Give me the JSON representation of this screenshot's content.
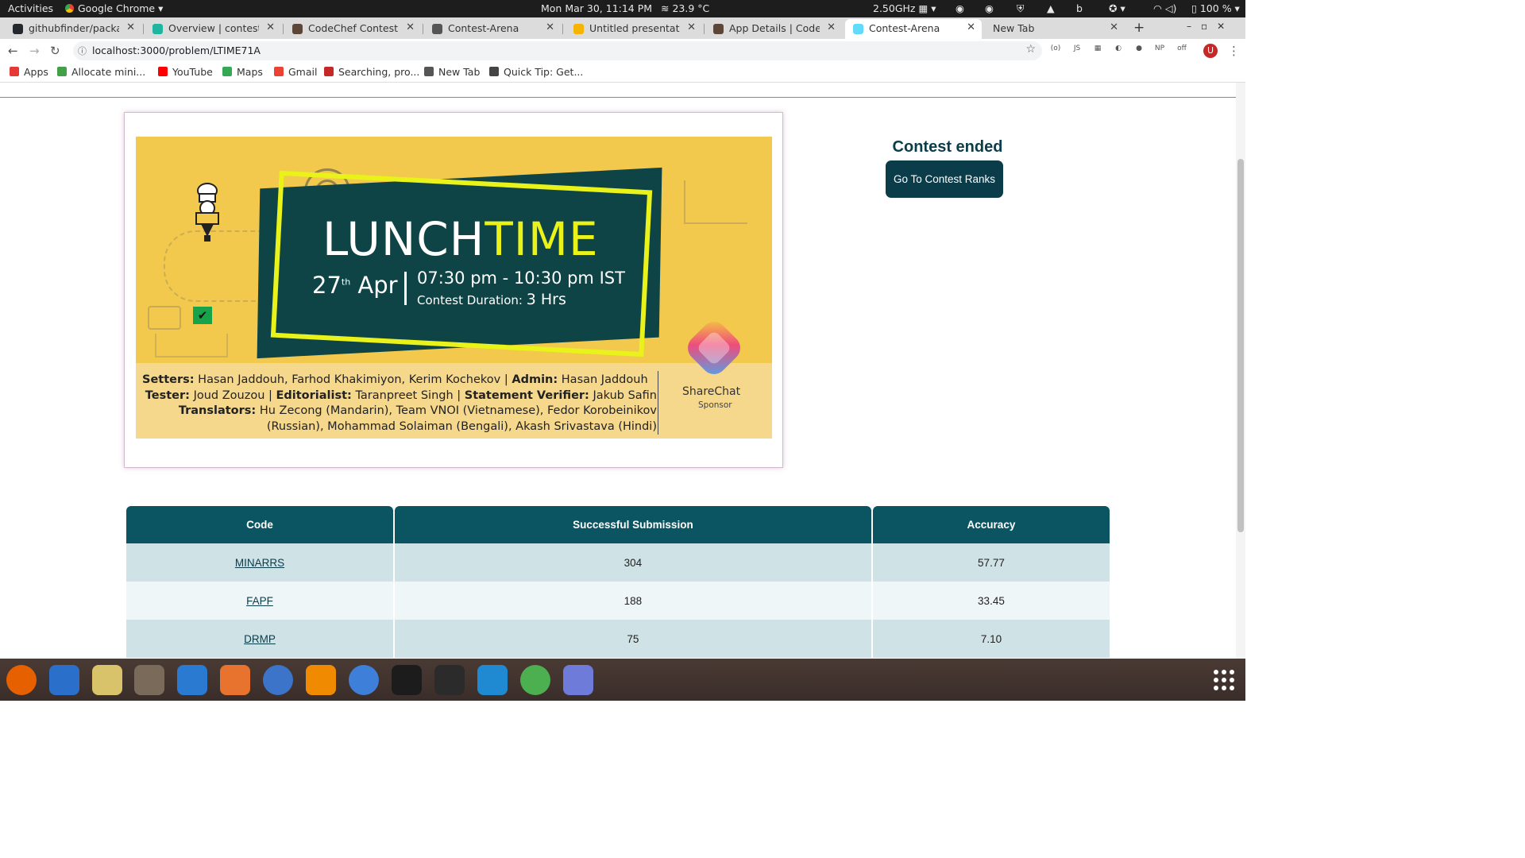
{
  "system": {
    "activities": "Activities",
    "app_name": "Google Chrome",
    "clock": "Mon Mar 30, 11:14 PM",
    "temperature": "23.9 °C",
    "cpu": "2.50GHz",
    "battery": "100 %"
  },
  "tabs": [
    {
      "label": "githubfinder/package",
      "icon_color": "#24292e"
    },
    {
      "label": "Overview | contestare",
      "icon_color": "#1fb5a0"
    },
    {
      "label": "CodeChef Contest Are",
      "icon_color": "#5b4638"
    },
    {
      "label": "Contest-Arena",
      "icon_color": "#555555"
    },
    {
      "label": "Untitled presentation",
      "icon_color": "#f4b400"
    },
    {
      "label": "App Details | CodeChe",
      "icon_color": "#5b4638"
    },
    {
      "label": "Contest-Arena",
      "icon_color": "#61dafb"
    },
    {
      "label": "New Tab",
      "icon_color": "#dcdcdc"
    }
  ],
  "new_tab_symbol": "+",
  "address_bar": {
    "url": "localhost:3000/problem/LTIME71A"
  },
  "bookmarks": [
    {
      "label": "Apps",
      "icon_color": "#e53935"
    },
    {
      "label": "Allocate mini...",
      "icon_color": "#43a047"
    },
    {
      "label": "YouTube",
      "icon_color": "#ff0000"
    },
    {
      "label": "Maps",
      "icon_color": "#34a853"
    },
    {
      "label": "Gmail",
      "icon_color": "#ea4335"
    },
    {
      "label": "Searching, pro...",
      "icon_color": "#c62828"
    },
    {
      "label": "New Tab",
      "icon_color": "#555555"
    },
    {
      "label": "Quick Tip: Get...",
      "icon_color": "#444444"
    }
  ],
  "extensions": [
    {
      "name": "reader-icon",
      "label": "(o)"
    },
    {
      "name": "node-icon",
      "label": "JS"
    },
    {
      "name": "grid-icon",
      "label": "▦"
    },
    {
      "name": "user-icon",
      "label": "◐"
    },
    {
      "name": "cookie-icon",
      "label": "●"
    },
    {
      "name": "np-icon",
      "label": "NP"
    },
    {
      "name": "toggle-off-icon",
      "label": "off"
    }
  ],
  "profile_initial": "U",
  "banner": {
    "title_part1": "LUNCH",
    "title_part2": "TIME",
    "date_day": "27",
    "date_suffix": "th",
    "date_month": "Apr",
    "time": "07:30 pm - 10:30 pm IST",
    "duration_label": "Contest Duration:",
    "duration_value": "3 Hrs",
    "credits_line1_label_a": "Setters:",
    "credits_line1_value_a": "Hasan Jaddouh, Farhod Khakimiyon, Kerim Kochekov",
    "credits_line1_label_b": "Admin:",
    "credits_line1_value_b": "Hasan Jaddouh",
    "credits_line2_label_a": "Tester:",
    "credits_line2_value_a": "Joud Zouzou",
    "credits_line2_label_b": "Editorialist:",
    "credits_line2_value_b": "Taranpreet Singh",
    "credits_line2_label_c": "Statement Verifier:",
    "credits_line2_value_c": "Jakub Safin",
    "credits_line3_label": "Translators:",
    "credits_line3_value": "Hu Zecong (Mandarin), Team VNOI (Vietnamese), Fedor Korobeinikov",
    "credits_line4_value": "(Russian), Mohammad Solaiman (Bengali), Akash Srivastava (Hindi)",
    "sponsor_name": "ShareChat",
    "sponsor_label": "Sponsor",
    "separator": "|"
  },
  "contest_status": {
    "title": "Contest ended",
    "ranks_button": "Go To Contest Ranks"
  },
  "problems_table": {
    "headers": [
      "Code",
      "Successful Submission",
      "Accuracy"
    ],
    "rows": [
      {
        "code": "MINARRS",
        "submissions": "304",
        "accuracy": "57.77"
      },
      {
        "code": "FAPF",
        "submissions": "188",
        "accuracy": "33.45"
      },
      {
        "code": "DRMP",
        "submissions": "75",
        "accuracy": "7.10"
      }
    ]
  },
  "dock": [
    {
      "name": "firefox-icon",
      "color": "#e66000"
    },
    {
      "name": "thunderbird-icon",
      "color": "#2a6fc9"
    },
    {
      "name": "rhythmbox-icon",
      "color": "#d9c36a"
    },
    {
      "name": "files-icon",
      "color": "#7a6a5a"
    },
    {
      "name": "writer-icon",
      "color": "#2a7ad1"
    },
    {
      "name": "software-icon",
      "color": "#e7732e"
    },
    {
      "name": "help-icon",
      "color": "#3b74c9"
    },
    {
      "name": "vlc-icon",
      "color": "#f08a00"
    },
    {
      "name": "chromium-icon",
      "color": "#3d7fd9"
    },
    {
      "name": "intellij-icon",
      "color": "#1c1c1c"
    },
    {
      "name": "terminal-icon",
      "color": "#2b2b2b"
    },
    {
      "name": "vscode-icon",
      "color": "#1f8ad2"
    },
    {
      "name": "chrome-icon",
      "color": "#4caf50"
    },
    {
      "name": "discord-icon",
      "color": "#6f7bd9"
    }
  ]
}
